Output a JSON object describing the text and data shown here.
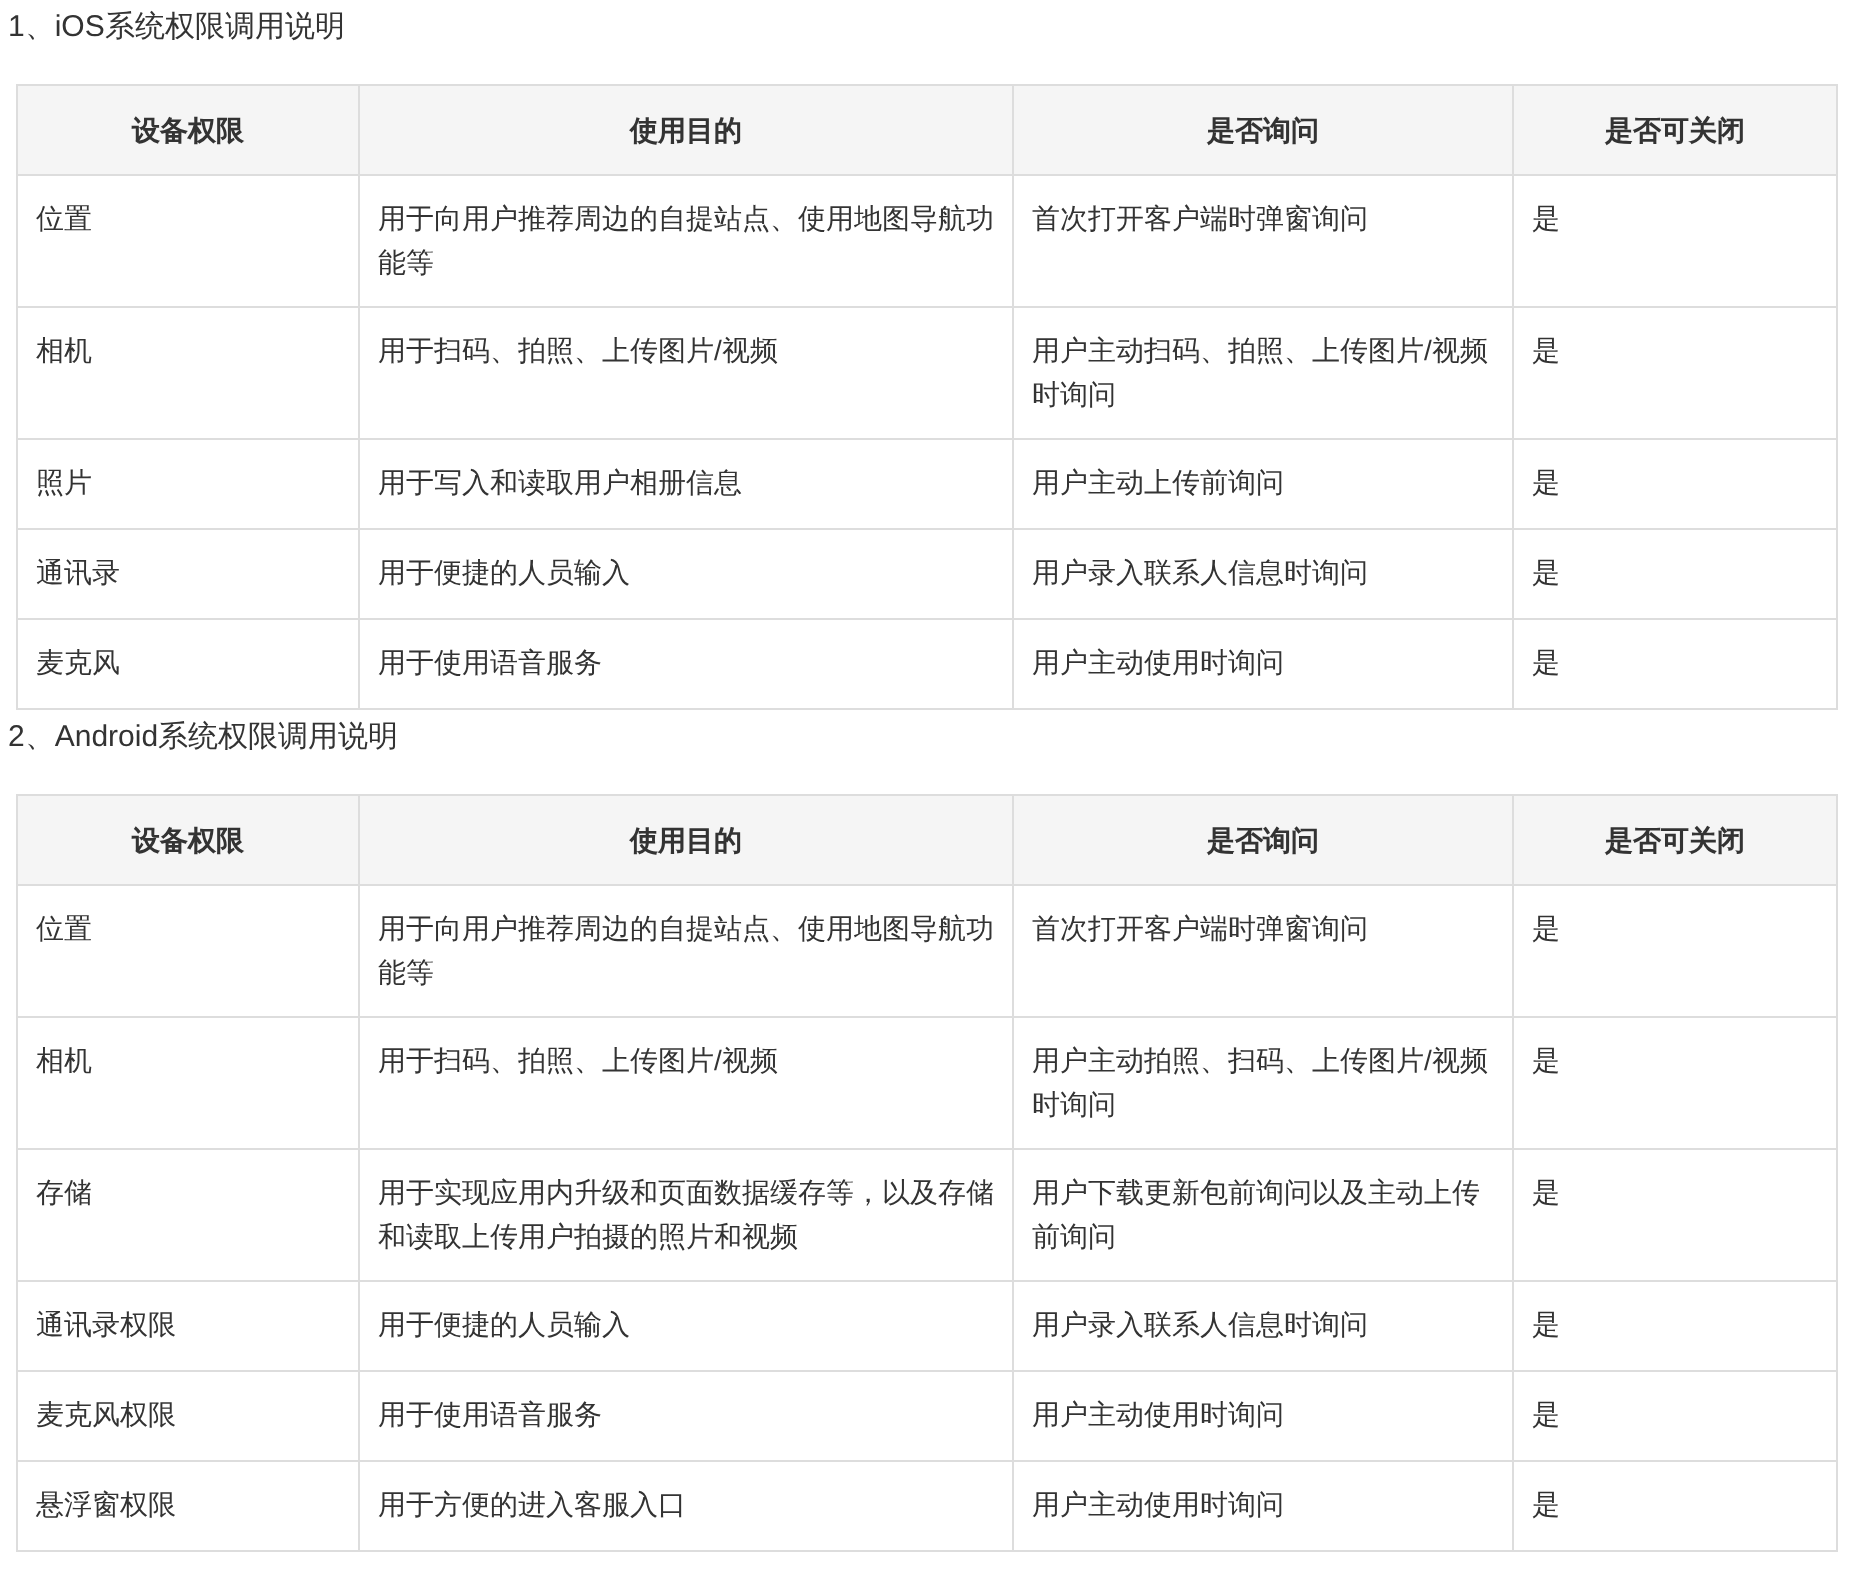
{
  "sections": [
    {
      "heading": "1、iOS系统权限调用说明",
      "columns": [
        "设备权限",
        "使用目的",
        "是否询问",
        "是否可关闭"
      ],
      "rows": [
        [
          "位置",
          "用于向用户推荐周边的自提站点、使用地图导航功能等",
          "首次打开客户端时弹窗询问",
          "是"
        ],
        [
          "相机",
          "用于扫码、拍照、上传图片/视频",
          "用户主动扫码、拍照、上传图片/视频时询问",
          "是"
        ],
        [
          "照片",
          "用于写入和读取用户相册信息",
          "用户主动上传前询问",
          "是"
        ],
        [
          "通讯录",
          "用于便捷的人员输入",
          "用户录入联系人信息时询问",
          "是"
        ],
        [
          "麦克风",
          "用于使用语音服务",
          "用户主动使用时询问",
          "是"
        ]
      ]
    },
    {
      "heading": "2、Android系统权限调用说明",
      "columns": [
        "设备权限",
        "使用目的",
        "是否询问",
        "是否可关闭"
      ],
      "rows": [
        [
          "位置",
          "用于向用户推荐周边的自提站点、使用地图导航功能等",
          "首次打开客户端时弹窗询问",
          "是"
        ],
        [
          "相机",
          "用于扫码、拍照、上传图片/视频",
          "用户主动拍照、扫码、上传图片/视频时询问",
          "是"
        ],
        [
          "存储",
          "用于实现应用内升级和页面数据缓存等，以及存储和读取上传用户拍摄的照片和视频",
          "用户下载更新包前询问以及主动上传前询问",
          "是"
        ],
        [
          "通讯录权限",
          "用于便捷的人员输入",
          "用户录入联系人信息时询问",
          "是"
        ],
        [
          "麦克风权限",
          "用于使用语音服务",
          "用户主动使用时询问",
          "是"
        ],
        [
          "悬浮窗权限",
          "用于方便的进入客服入口",
          "用户主动使用时询问",
          "是"
        ]
      ]
    }
  ]
}
